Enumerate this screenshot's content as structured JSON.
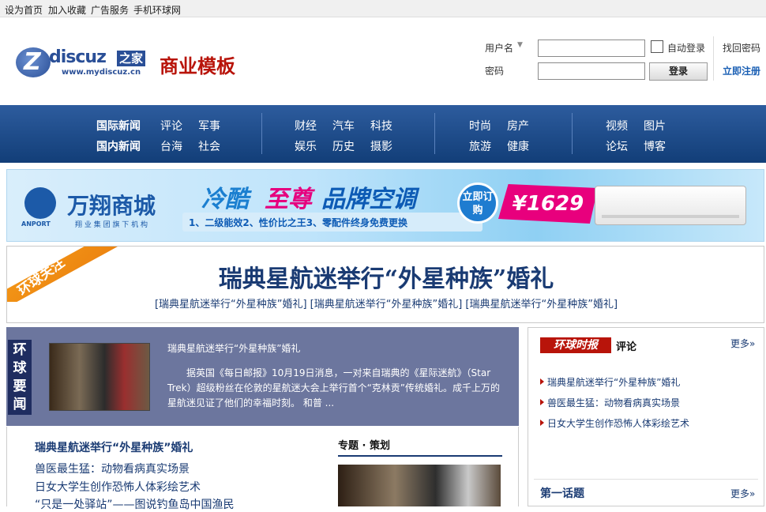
{
  "topbar": {
    "links": [
      "设为首页",
      "加入收藏",
      "广告服务",
      "手机环球网"
    ]
  },
  "logo": {
    "brand": "discuz",
    "home_badge": "之家",
    "url": "www.mydiscuz.cn",
    "tagline": "商业模板"
  },
  "login": {
    "username_label": "用户名",
    "password_label": "密码",
    "username_value": "",
    "password_value": "",
    "auto_login_label": "自动登录",
    "login_button": "登录",
    "find_password": "找回密码",
    "register": "立即注册"
  },
  "nav": {
    "groups": [
      {
        "items": [
          "国际新闻",
          "评论",
          "军事",
          "国内新闻",
          "台海",
          "社会"
        ]
      },
      {
        "items": [
          "财经",
          "汽车",
          "科技",
          "娱乐",
          "历史",
          "摄影"
        ]
      },
      {
        "items": [
          "时尚",
          "房产",
          "旅游",
          "健康"
        ]
      },
      {
        "items": [
          "视频",
          "图片",
          "论坛",
          "博客"
        ]
      }
    ]
  },
  "banner": {
    "brand": "万翔商城",
    "brand_en": "ANPORT",
    "brand_sub": "翔 业 集 团 旗 下 机 构",
    "slogan_part1": "冷酷",
    "slogan_part2": "至尊",
    "slogan_part3": "品牌空调",
    "features": "1、二级能效2、性价比之王3、零配件终身免费更换",
    "order_badge": "立即订购",
    "price": "¥1629"
  },
  "headline": {
    "tag": "环球关注",
    "title": "瑞典星航迷举行“外星种族”婚礼",
    "links": "[瑞典星航迷举行“外星种族”婚礼] [瑞典星航迷举行“外星种族”婚礼] [瑞典星航迷举行“外星种族”婚礼]"
  },
  "news": {
    "label": "环球要闻",
    "title": "瑞典星航迷举行“外星种族”婚礼",
    "body": "据英国《每日邮报》10月19日消息，一对来自瑞典的《星际迷航》（Star Trek）超级粉丝在伦敦的星航迷大会上举行首个“克林贡”传统婚礼。成千上万的星航迷见证了他们的幸福时刻。    和普 ..."
  },
  "list": {
    "headline": "瑞典星航迷举行“外星种族”婚礼",
    "items": [
      "兽医最生猛：动物看病真实场景",
      "日女大学生创作恐怖人体彩绘艺术",
      "“只是一处驿站”——图说钓鱼岛中国渔民"
    ]
  },
  "topic": {
    "title": "专题 · 策划"
  },
  "right": {
    "logo": "环球时报",
    "title": "评论",
    "more": "更多»",
    "items": [
      "瑞典星航迷举行“外星种族”婚礼",
      "兽医最生猛：动物看病真实场景",
      "日女大学生创作恐怖人体彩绘艺术"
    ],
    "section2": "第一话题",
    "more2": "更多»"
  }
}
